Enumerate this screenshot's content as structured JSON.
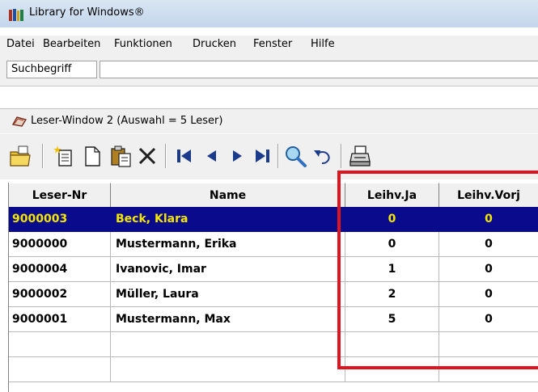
{
  "window": {
    "title": "Library for Windows®"
  },
  "menu": [
    "Datei",
    "Bearbeiten",
    "Funktionen",
    "Drucken",
    "Fenster",
    "Hilfe"
  ],
  "search": {
    "label": "Suchbegriff",
    "value": ""
  },
  "child_window": {
    "title": "Leser-Window 2  (Auswahl = 5  Leser)"
  },
  "toolbar": {
    "icons": [
      "open-folder-icon",
      "new-record-icon",
      "blank-page-icon",
      "paste-icon",
      "delete-icon",
      "first-record-icon",
      "previous-record-icon",
      "next-record-icon",
      "last-record-icon",
      "search-icon",
      "undo-icon",
      "print-icon"
    ]
  },
  "table": {
    "columns": [
      "Leser-Nr",
      "Name",
      "Leihv.Ja",
      "Leihv.Vorj"
    ],
    "rows": [
      {
        "nr": "9000003",
        "name": "Beck, Klara",
        "ja": "0",
        "vorj": "0",
        "selected": true
      },
      {
        "nr": "9000000",
        "name": "Mustermann, Erika",
        "ja": "0",
        "vorj": "0",
        "selected": false
      },
      {
        "nr": "9000004",
        "name": "Ivanovic, Imar",
        "ja": "1",
        "vorj": "0",
        "selected": false
      },
      {
        "nr": "9000002",
        "name": "Müller, Laura",
        "ja": "2",
        "vorj": "0",
        "selected": false
      },
      {
        "nr": "9000001",
        "name": "Mustermann, Max",
        "ja": "5",
        "vorj": "0",
        "selected": false
      }
    ]
  },
  "colors": {
    "selection_bg": "#0a0a8c",
    "selection_text": "#f5e600",
    "highlight_border": "#e0141e"
  }
}
